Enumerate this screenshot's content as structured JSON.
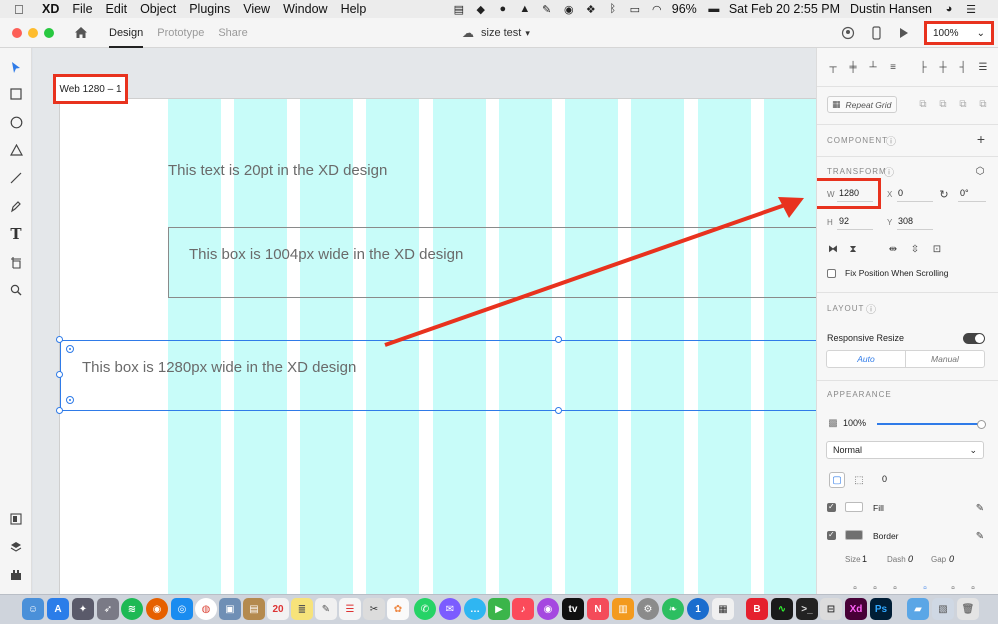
{
  "menubar": {
    "app_name": "XD",
    "items": [
      "File",
      "Edit",
      "Object",
      "Plugins",
      "View",
      "Window",
      "Help"
    ],
    "battery": "96%",
    "datetime": "Sat Feb 20  2:55 PM",
    "user": "Dustin Hansen"
  },
  "titlebar": {
    "tabs": [
      {
        "label": "Design",
        "active": true
      },
      {
        "label": "Prototype",
        "active": false
      },
      {
        "label": "Share",
        "active": false
      }
    ],
    "document_title": "size test",
    "zoom": "100%"
  },
  "canvas": {
    "artboard_label": "Web 1280 – 1",
    "text_20pt": "This text is 20pt in the XD design",
    "box_1004": "This box is 1004px wide in the XD design",
    "box_1280": "This box is 1280px wide in the XD design"
  },
  "panel": {
    "repeat_grid": "Repeat Grid",
    "component_title": "COMPONENT",
    "transform_title": "TRANSFORM",
    "w_label": "W",
    "w_value": "1280",
    "x_label": "X",
    "x_value": "0",
    "rotation_value": "0°",
    "h_label": "H",
    "h_value": "92",
    "y_label": "Y",
    "y_value": "308",
    "fix_position": "Fix Position When Scrolling",
    "layout_title": "LAYOUT",
    "responsive_resize": "Responsive Resize",
    "seg_auto": "Auto",
    "seg_manual": "Manual",
    "appearance_title": "APPEARANCE",
    "opacity": "100%",
    "blend_mode": "Normal",
    "corner_radius": "0",
    "fill_label": "Fill",
    "border_label": "Border",
    "size_label": "Size",
    "size_value": "1",
    "dash_label": "Dash",
    "dash_value": "0",
    "gap_label": "Gap",
    "gap_value": "0"
  },
  "colors": {
    "annotation_red": "#e8321e",
    "selection_blue": "#2f7be8",
    "grid_column": "#c8fcf9"
  }
}
